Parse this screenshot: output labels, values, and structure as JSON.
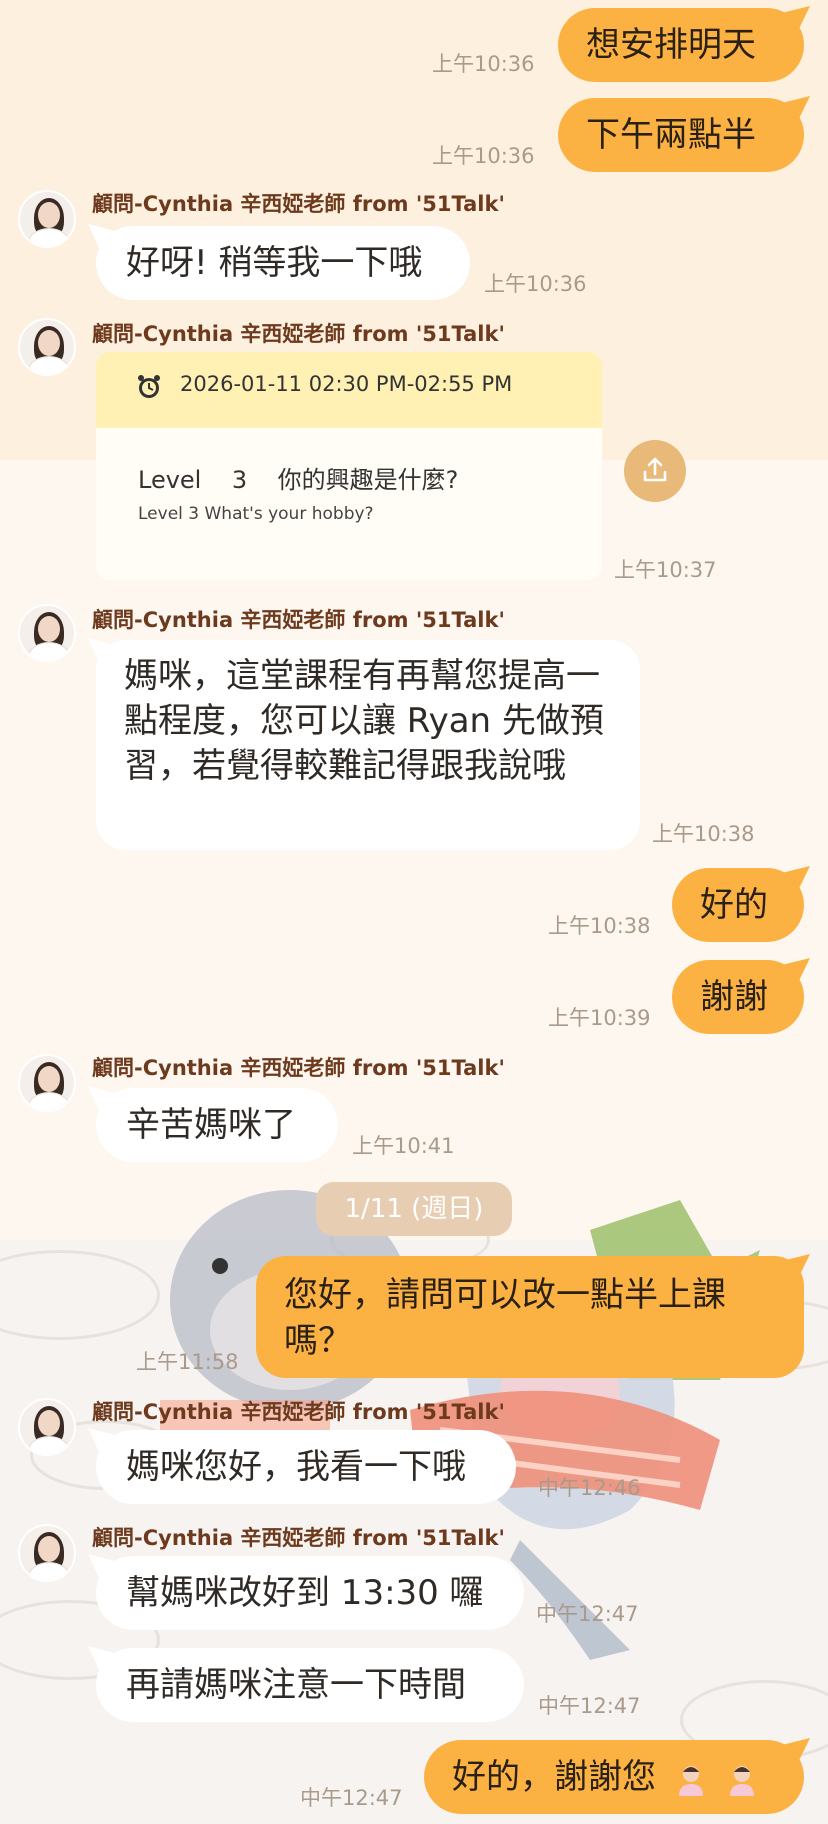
{
  "colors": {
    "outgoing_bubble": "#fbb243",
    "incoming_bubble": "#ffffff",
    "sender_name": "#6e3a1e",
    "timestamp": "#a99a8c",
    "date_pill": "#e7cdb2",
    "card_header": "#fff0b4"
  },
  "icons": {
    "alarm": "alarm-clock-icon",
    "share": "share-upload-icon",
    "emoji": "person-shrugging-emoji-icon",
    "avatar": "consultant-avatar"
  },
  "sender_name": "顧問-Cynthia 辛西婭老師 from '51Talk'",
  "messages": {
    "m1": {
      "text": "想安排明天",
      "time": "上午10:36"
    },
    "m2": {
      "text": "下午兩點半",
      "time": "上午10:36"
    },
    "m3": {
      "text": "好呀! 稍等我一下哦",
      "time": "上午10:36"
    },
    "m4": {
      "card_datetime": "2026-01-11 02:30 PM-02:55 PM",
      "card_line1": "Level    3    你的興趣是什麼?",
      "card_line2": "Level 3 What's your hobby?",
      "time": "上午10:37"
    },
    "m5": {
      "text": "媽咪，這堂課程有再幫您提高一點程度，您可以讓 Ryan 先做預習，若覺得較難記得跟我說哦",
      "time": "上午10:38"
    },
    "m6": {
      "text": "好的",
      "time": "上午10:38"
    },
    "m7": {
      "text": "謝謝",
      "time": "上午10:39"
    },
    "m8": {
      "text": "辛苦媽咪了",
      "time": "上午10:41"
    },
    "m9": {
      "text": "您好，請問可以改一點半上課嗎？",
      "time": "上午11:58"
    },
    "m10": {
      "text": "媽咪您好，我看一下哦",
      "time": "中午12:46"
    },
    "m11": {
      "text": "幫媽咪改好到 13:30 囉",
      "time": "中午12:47"
    },
    "m12": {
      "text": "再請媽咪注意一下時間",
      "time": "中午12:47"
    },
    "m13": {
      "text": "好的，謝謝您",
      "time": "中午12:47"
    }
  },
  "date_separator": "1/11 (週日)"
}
